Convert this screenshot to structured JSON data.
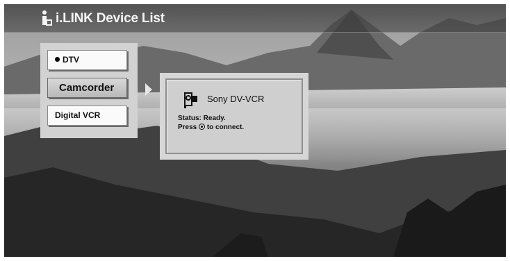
{
  "header": {
    "title": "i.LINK Device List",
    "icon": "ilink-icon"
  },
  "devices": {
    "items": [
      {
        "label": "DTV",
        "selected": true
      },
      {
        "label": "Camcorder",
        "focused": true
      },
      {
        "label": "Digital VCR"
      }
    ]
  },
  "details": {
    "device_name": "Sony DV-VCR",
    "status": "Status: Ready.",
    "press_prefix": "Press",
    "press_suffix": "to connect.",
    "icon": "camcorder-icon"
  },
  "colors": {
    "panel": "#d2d2d2",
    "button": "#fafafa",
    "focused_button": "#c4c4c4",
    "title_text": "#f4f4f4"
  }
}
